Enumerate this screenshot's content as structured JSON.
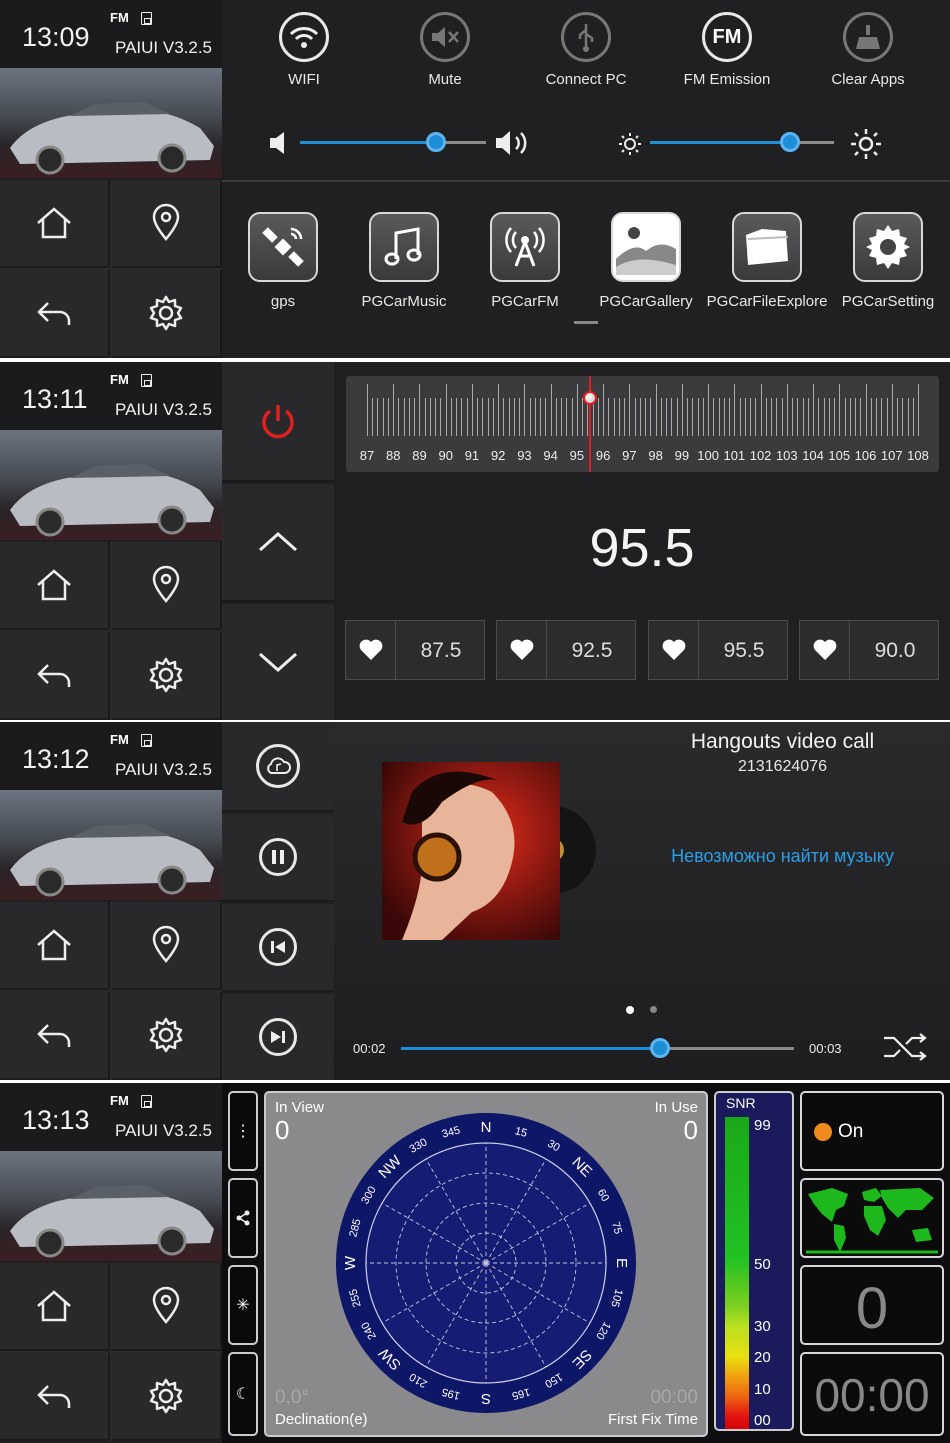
{
  "panels": [
    {
      "clock": "13:09",
      "fm": "FM",
      "version": "PAIUI V3.2.5"
    },
    {
      "clock": "13:11",
      "fm": "FM",
      "version": "PAIUI V3.2.5"
    },
    {
      "clock": "13:12",
      "fm": "FM",
      "version": "PAIUI V3.2.5"
    },
    {
      "clock": "13:13",
      "fm": "FM",
      "version": "PAIUI V3.2.5"
    }
  ],
  "nav_icons": [
    "home-icon",
    "location-pin-icon",
    "back-icon",
    "settings-gear-icon"
  ],
  "quick_toggles": [
    {
      "label": "WIFI",
      "icon": "wifi-icon"
    },
    {
      "label": "Mute",
      "icon": "mute-icon"
    },
    {
      "label": "Connect PC",
      "icon": "usb-icon"
    },
    {
      "label": "FM Emission",
      "icon_text": "FM",
      "icon": "fm-icon"
    },
    {
      "label": "Clear Apps",
      "icon": "broom-icon"
    }
  ],
  "volume_level": 0.73,
  "brightness_level": 0.76,
  "apps": [
    {
      "label": "gps",
      "icon": "satellite-icon"
    },
    {
      "label": "PGCarMusic",
      "icon": "music-note-icon"
    },
    {
      "label": "PGCarFM",
      "icon": "radio-tower-icon"
    },
    {
      "label": "PGCarGallery",
      "icon": "gallery-icon"
    },
    {
      "label": "PGCarFileExplore",
      "icon": "folder-icon"
    },
    {
      "label": "PGCarSetting",
      "icon": "gear-icon"
    }
  ],
  "radio": {
    "frequency": "95.5",
    "scale": [
      "87",
      "88",
      "89",
      "90",
      "91",
      "92",
      "93",
      "94",
      "95",
      "96",
      "97",
      "98",
      "99",
      "100",
      "101",
      "102",
      "103",
      "104",
      "105",
      "106",
      "107",
      "108"
    ],
    "tuned_position": 95.5,
    "presets": [
      "87.5",
      "92.5",
      "95.5",
      "90.0"
    ],
    "accent": "#e02020"
  },
  "music": {
    "title": "Hangouts video call",
    "number": "2131624076",
    "message": "Невозможно найти музыку",
    "elapsed": "00:02",
    "total": "00:03",
    "progress": 0.66,
    "accent": "#1e8ed8"
  },
  "gps": {
    "in_view_label": "In View",
    "in_view": "0",
    "in_use_label": "In Use",
    "in_use": "0",
    "compass_labels": [
      "N",
      "15",
      "30",
      "NE",
      "60",
      "75",
      "E",
      "105",
      "120",
      "SE",
      "150",
      "165",
      "S",
      "195",
      "210",
      "SW",
      "240",
      "255",
      "W",
      "285",
      "300",
      "NW",
      "330",
      "345"
    ],
    "declination_value": "0,0°",
    "declination_label": "Declination(e)",
    "fix_time_value": "00:00",
    "fix_time_label": "First Fix Time",
    "snr_title": "SNR",
    "snr_ticks": [
      "99",
      "50",
      "30",
      "20",
      "10",
      "00"
    ],
    "on_label": "On",
    "satellite_count": "0",
    "timer": "00:00",
    "side_icons": [
      "more-icon",
      "share-icon",
      "star-icon",
      "moon-icon"
    ]
  }
}
